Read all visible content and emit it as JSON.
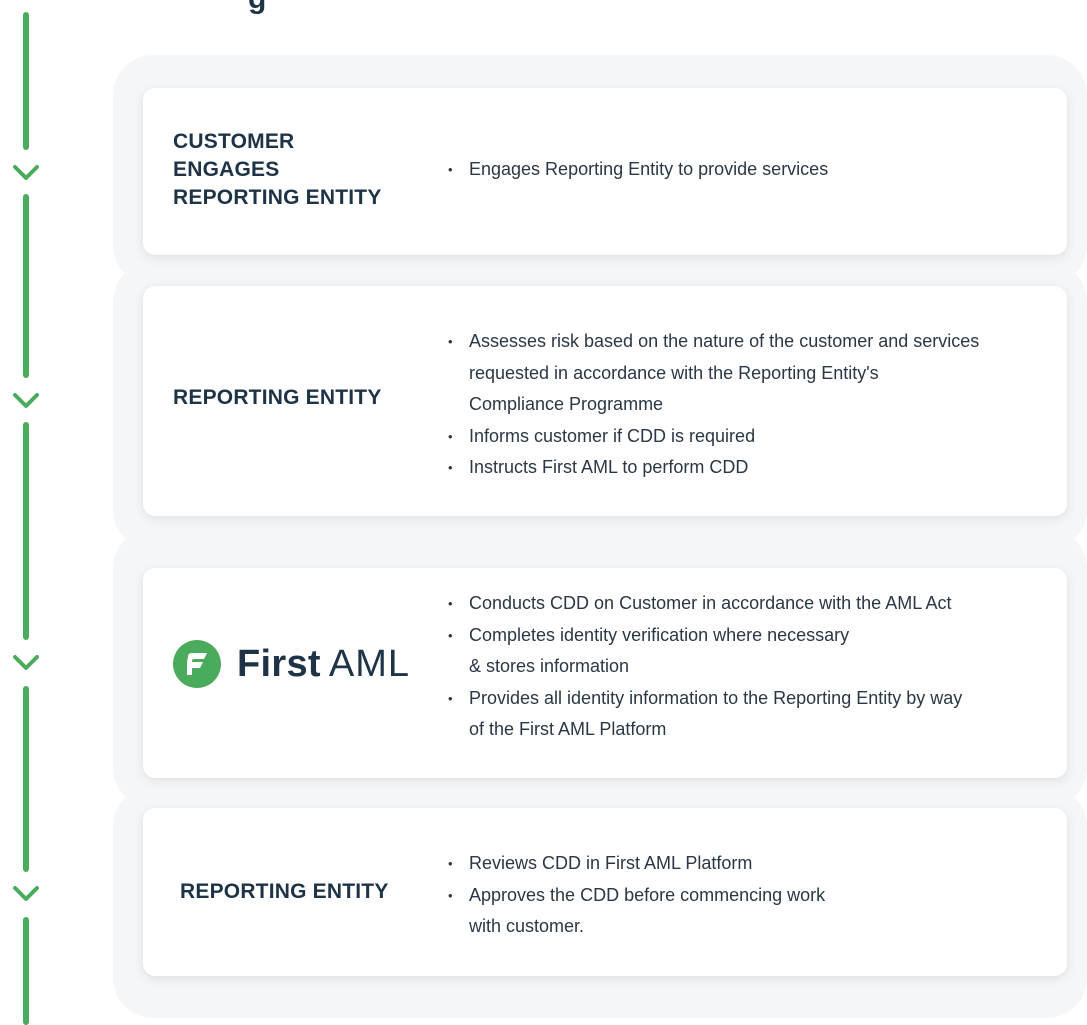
{
  "heading_partial": "g",
  "colors": {
    "accent_green": "#4aab5c",
    "text_navy": "#1f3347"
  },
  "steps": [
    {
      "title": "CUSTOMER ENGAGES REPORTING ENTITY",
      "title_lines": [
        "CUSTOMER",
        "ENGAGES",
        "REPORTING ENTITY"
      ],
      "bullets": [
        "Engages Reporting Entity to provide services"
      ]
    },
    {
      "title": "REPORTING ENTITY",
      "bullets": [
        "Assesses risk based on the nature of the customer and services",
        "requested in accordance with the  Reporting Entity's",
        "Compliance Programme",
        "Informs customer if CDD is required",
        "Instructs First AML to perform CDD"
      ]
    },
    {
      "logo": {
        "icon": "first-aml-logo-icon",
        "word_bold": "First",
        "word_light": "AML"
      },
      "bullets": [
        "Conducts CDD on Customer in accordance with the AML Act",
        "Completes identity verification where necessary",
        "& stores information",
        "Provides all identity information to the Reporting Entity by way",
        "of the First AML Platform"
      ]
    },
    {
      "title": "REPORTING ENTITY",
      "bullets": [
        "Reviews CDD in First AML Platform",
        "Approves the CDD before commencing work",
        "with customer."
      ]
    }
  ],
  "timeline": {
    "icon": "chevron-down-icon"
  }
}
